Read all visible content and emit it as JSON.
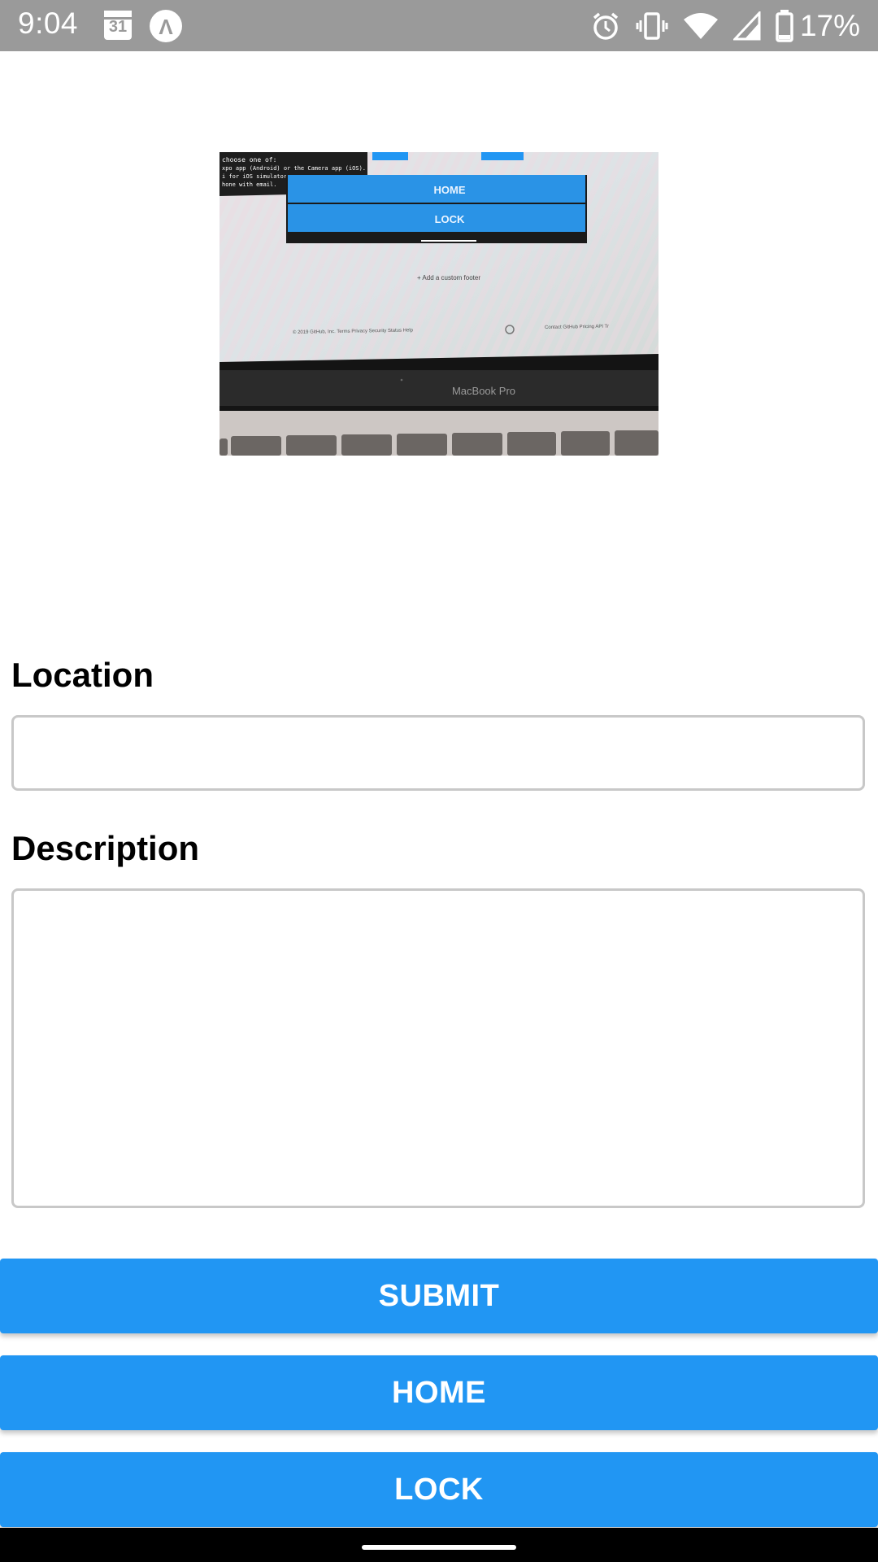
{
  "status_bar": {
    "time": "9:04",
    "calendar_day": "31",
    "battery_text": "17%",
    "icons": [
      "calendar-icon",
      "app-notification-icon",
      "alarm-icon",
      "vibrate-icon",
      "wifi-icon",
      "cell-signal-icon",
      "battery-icon"
    ]
  },
  "photo": {
    "screen_text": {
      "terminal_line1": "choose one of:",
      "terminal_line2": "xpo app (Android) or the Camera app (iOS).",
      "terminal_line3": "i for iOS simulator.",
      "terminal_line4": "hone with email.",
      "home": "HOME",
      "lock": "LOCK",
      "footer": "+ Add a custom footer",
      "github_footer": "© 2019 GitHub, Inc.   Terms   Privacy   Security   Status   Help",
      "github_right": "Contact GitHub   Pricing   API   Tr",
      "laptop_brand": "MacBook Pro"
    },
    "colors": {
      "accent": "#2196f3"
    }
  },
  "form": {
    "location_label": "Location",
    "location_value": "",
    "description_label": "Description",
    "description_value": ""
  },
  "buttons": {
    "submit": "SUBMIT",
    "home": "HOME",
    "lock": "LOCK"
  },
  "colors": {
    "accent": "#2196f3",
    "status_bar": "#9a9a9a"
  }
}
